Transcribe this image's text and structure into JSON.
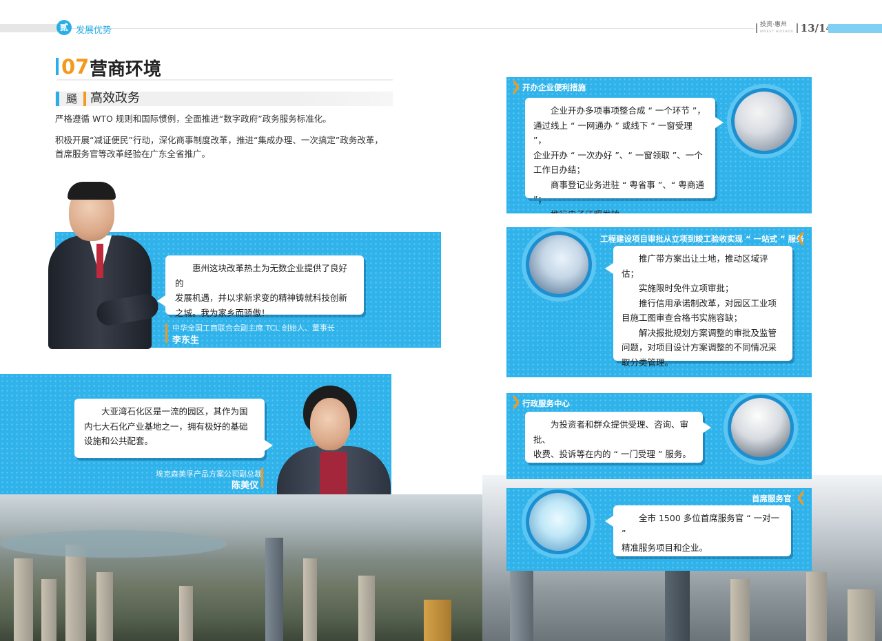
{
  "header": {
    "badge": "贰",
    "section": "发展优势",
    "brand": "投资·惠州",
    "brand_sub": "INVEST HUIZHOU",
    "page": "13/14"
  },
  "title": {
    "number": "07",
    "text": "营商环境"
  },
  "subtitle": {
    "icon": "颾",
    "text": "高效政务"
  },
  "paragraphs": [
    "严格遵循 WTO 规则和国际惯例，全面推进“数字政府”政务服务标准化。",
    "积极开展“减证便民”行动，深化商事制度改革，推进“集成办理、一次搞定”政务改革，",
    "首席服务官等改革经验在广东全省推广。"
  ],
  "quote1": {
    "lines": [
      "惠州这块改革热土为无数企业提供了良好的",
      "发展机遇，并以求新求变的精神铸就科技创新",
      "之城。我为家乡而骄傲！"
    ],
    "role": "中华全国工商联合会副主席   TCL 创始人、董事长",
    "name": "李东生"
  },
  "quote2": {
    "lines": [
      "大亚湾石化区是一流的园区，其作为国",
      "内七大石化产业基地之一，拥有极好的基础",
      "设施和公共配套。"
    ],
    "role": "埃克森美孚产品方案公司副总裁",
    "name": "陈美仪"
  },
  "panels": [
    {
      "title": "开办企业便利措施",
      "lines": [
        "企业开办多项事项整合成 “ 一个环节 ”，",
        "通过线上 “ 一网通办 ” 或线下 “ 一窗受理 ”，",
        "企业开办 “ 一次办好 ”、“ 一窗领取 ”、一个",
        "工作日办结；",
        "商事登记业务进驻 “ 粤省事 ”、“ 粤商通 ”；",
        "推行电子证照发放。"
      ]
    },
    {
      "title": "工程建设项目审批从立项到竣工验收实现 “ 一站式 ” 服务",
      "lines": [
        "推广带方案出让土地，推动区域评估；",
        "实施限时免件立项审批；",
        "推行信用承诺制改革，对园区工业项",
        "目施工图审查合格书实施容缺；",
        "解决报批规划方案调整的审批及监管",
        "问题，对项目设计方案调整的不同情况采",
        "取分类管理。"
      ]
    },
    {
      "title": "行政服务中心",
      "lines": [
        "为投资者和群众提供受理、咨询、审批、",
        "收费、投诉等在内的 “ 一门受理 ” 服务。"
      ]
    },
    {
      "title": "首席服务官",
      "lines": [
        "全市 1500 多位首席服务官 “ 一对一 ”",
        "精准服务项目和企业。"
      ]
    }
  ]
}
